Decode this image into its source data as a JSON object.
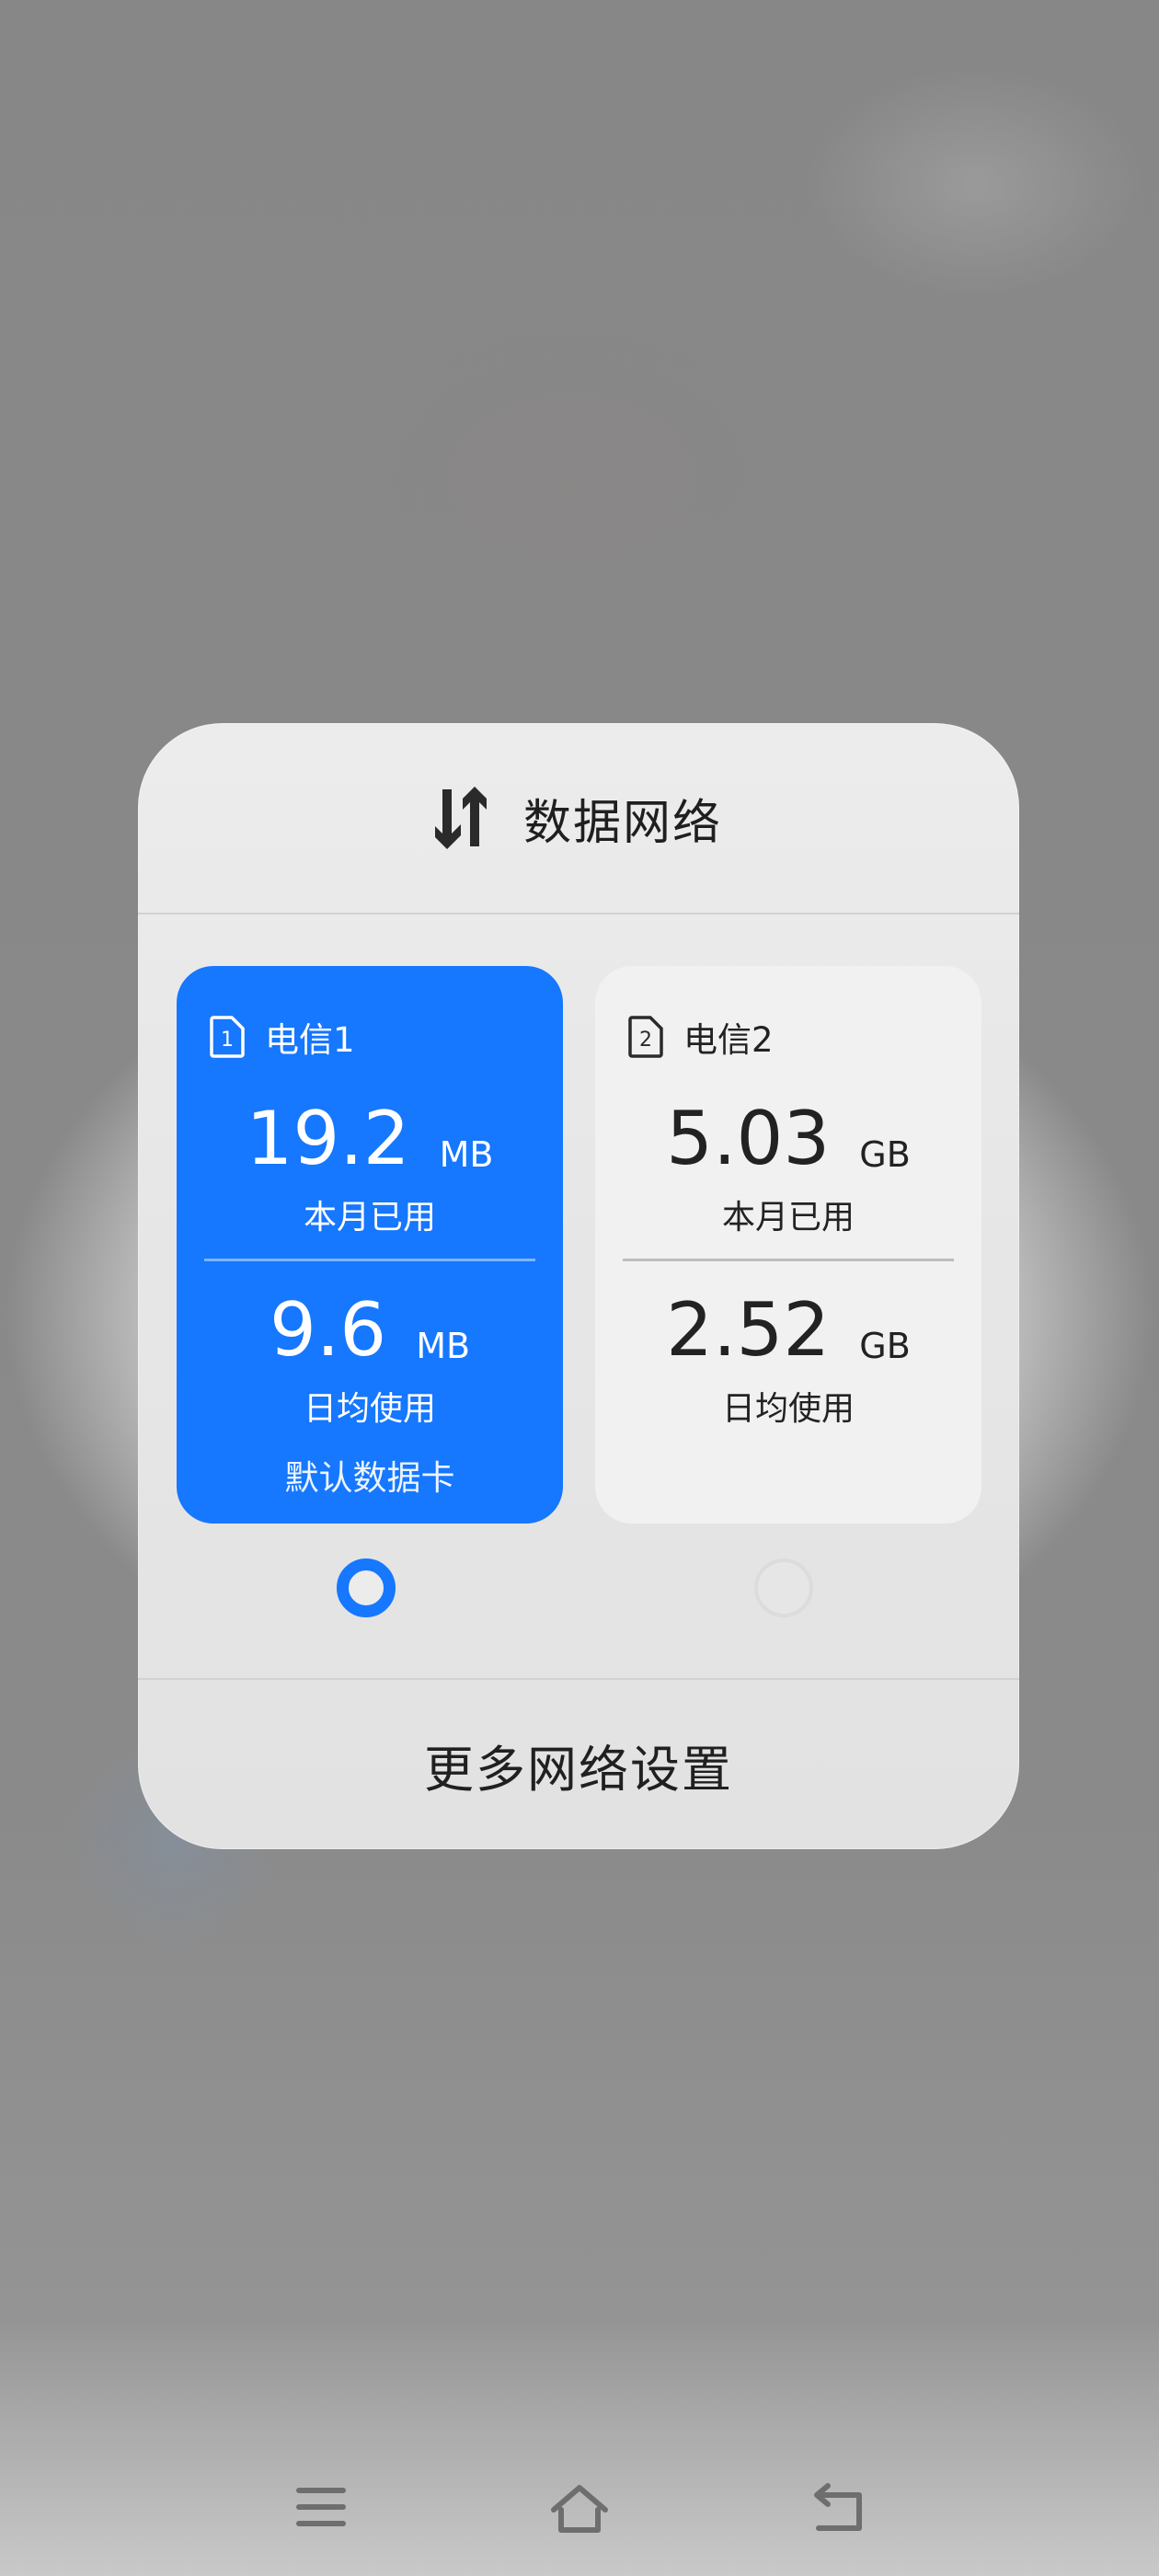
{
  "panel": {
    "title": "数据网络",
    "title_icon": "data-arrows-icon",
    "footer_label": "更多网络设置"
  },
  "sims": [
    {
      "name": "电信1",
      "icon": "sim-card-1-icon",
      "monthly_value": "19.2",
      "monthly_unit": "MB",
      "monthly_label": "本月已用",
      "daily_value": "9.6",
      "daily_unit": "MB",
      "daily_label": "日均使用",
      "default_label": "默认数据卡",
      "selected": true
    },
    {
      "name": "电信2",
      "icon": "sim-card-2-icon",
      "monthly_value": "5.03",
      "monthly_unit": "GB",
      "monthly_label": "本月已用",
      "daily_value": "2.52",
      "daily_unit": "GB",
      "daily_label": "日均使用",
      "selected": false
    }
  ],
  "navbar": {
    "items": [
      "menu-icon",
      "home-icon",
      "back-icon"
    ]
  },
  "colors": {
    "accent": "#1677ff",
    "panel_bg": "#e7e7e7",
    "card_inactive": "#f1f1f1"
  }
}
